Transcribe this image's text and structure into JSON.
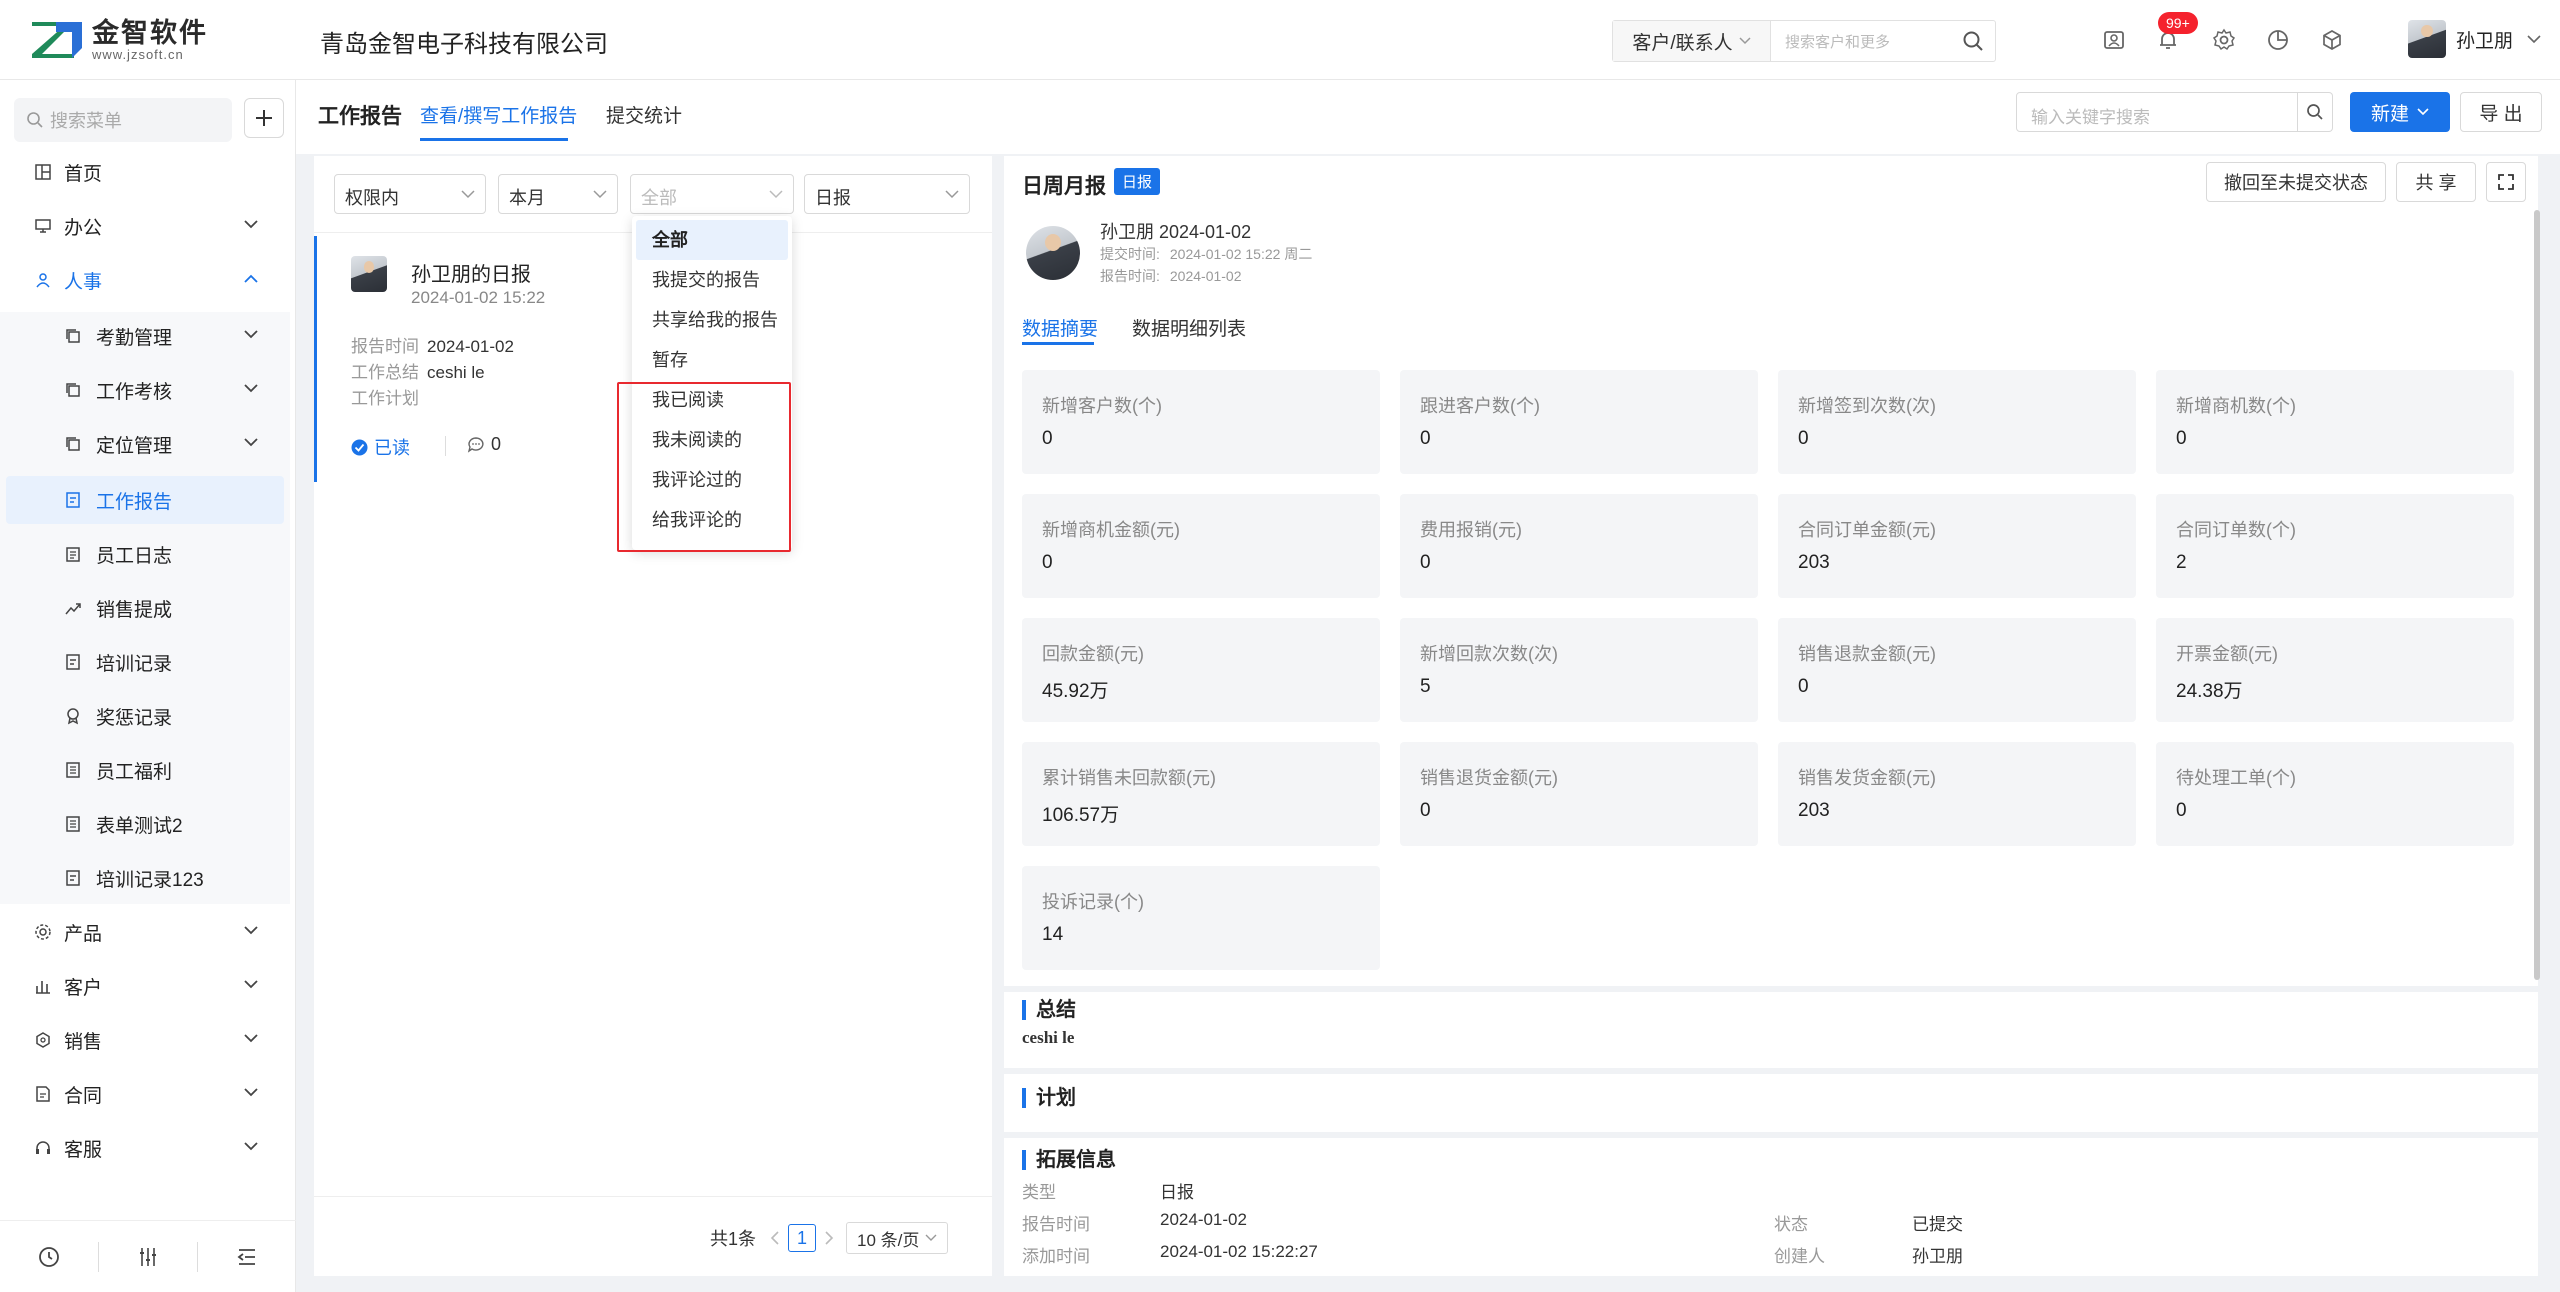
{
  "header": {
    "logo_name": "金智软件",
    "logo_url": "www.jzsoft.cn",
    "company": "青岛金智电子科技有限公司",
    "search_type": "客户/联系人",
    "search_placeholder": "搜索客户和更多",
    "notification_count": "99+",
    "user_name": "孙卫朋"
  },
  "sidebar": {
    "search_placeholder": "搜索菜单",
    "items": [
      {
        "label": "首页"
      },
      {
        "label": "办公"
      },
      {
        "label": "人事"
      },
      {
        "label": "考勤管理"
      },
      {
        "label": "工作考核"
      },
      {
        "label": "定位管理"
      },
      {
        "label": "工作报告"
      },
      {
        "label": "员工日志"
      },
      {
        "label": "销售提成"
      },
      {
        "label": "培训记录"
      },
      {
        "label": "奖惩记录"
      },
      {
        "label": "员工福利"
      },
      {
        "label": "表单测试2"
      },
      {
        "label": "培训记录123"
      },
      {
        "label": "产品"
      },
      {
        "label": "客户"
      },
      {
        "label": "销售"
      },
      {
        "label": "合同"
      },
      {
        "label": "客服"
      }
    ]
  },
  "page": {
    "title": "工作报告",
    "tabs": [
      "查看/撰写工作报告",
      "提交统计"
    ],
    "keyword_placeholder": "输入关键字搜索",
    "new_label": "新建",
    "export_label": "导 出"
  },
  "filters": {
    "scope": "权限内",
    "period": "本月",
    "status": "全部",
    "type": "日报"
  },
  "dropdown": {
    "options": [
      "全部",
      "我提交的报告",
      "共享给我的报告",
      "暂存",
      "我已阅读",
      "我未阅读的",
      "我评论过的",
      "给我评论的"
    ]
  },
  "report_card": {
    "title": "孙卫朋的日报",
    "time": "2024-01-02 15:22",
    "report_time_label": "报告时间",
    "report_time": "2024-01-02",
    "summary_label": "工作总结",
    "summary": "ceshi le",
    "plan_label": "工作计划",
    "read_label": "已读",
    "comment_count": "0"
  },
  "pager": {
    "total": "共1条",
    "current": "1",
    "page_size": "10 条/页"
  },
  "detail": {
    "title": "日周月报",
    "tag": "日报",
    "revoke_label": "撤回至未提交状态",
    "share_label": "共 享",
    "author_line": "孙卫朋 2024-01-02",
    "submit_time_label": "提交时间:",
    "submit_time": "2024-01-02 15:22 周二",
    "report_time_label": "报告时间:",
    "report_time": "2024-01-02",
    "tabs": [
      "数据摘要",
      "数据明细列表"
    ],
    "stats": [
      {
        "label": "新增客户数(个)",
        "value": "0"
      },
      {
        "label": "跟进客户数(个)",
        "value": "0"
      },
      {
        "label": "新增签到次数(次)",
        "value": "0"
      },
      {
        "label": "新增商机数(个)",
        "value": "0"
      },
      {
        "label": "新增商机金额(元)",
        "value": "0"
      },
      {
        "label": "费用报销(元)",
        "value": "0"
      },
      {
        "label": "合同订单金额(元)",
        "value": "203"
      },
      {
        "label": "合同订单数(个)",
        "value": "2"
      },
      {
        "label": "回款金额(元)",
        "value": "45.92万"
      },
      {
        "label": "新增回款次数(次)",
        "value": "5"
      },
      {
        "label": "销售退款金额(元)",
        "value": "0"
      },
      {
        "label": "开票金额(元)",
        "value": "24.38万"
      },
      {
        "label": "累计销售未回款额(元)",
        "value": "106.57万"
      },
      {
        "label": "销售退货金额(元)",
        "value": "0"
      },
      {
        "label": "销售发货金额(元)",
        "value": "203"
      },
      {
        "label": "待处理工单(个)",
        "value": "0"
      },
      {
        "label": "投诉记录(个)",
        "value": "14"
      }
    ]
  },
  "summary_section": {
    "title": "总结",
    "content": "ceshi le"
  },
  "plan_section": {
    "title": "计划"
  },
  "ext_section": {
    "title": "拓展信息",
    "type_label": "类型",
    "type_value": "日报",
    "report_time_label": "报告时间",
    "report_time_value": "2024-01-02",
    "add_time_label": "添加时间",
    "add_time_value": "2024-01-02 15:22:27",
    "status_label": "状态",
    "status_value": "已提交",
    "creator_label": "创建人",
    "creator_value": "孙卫朋"
  },
  "colors": {
    "accent": "#1a73e8",
    "badge": "#f5222d",
    "highlight_box": "#e8292f"
  }
}
